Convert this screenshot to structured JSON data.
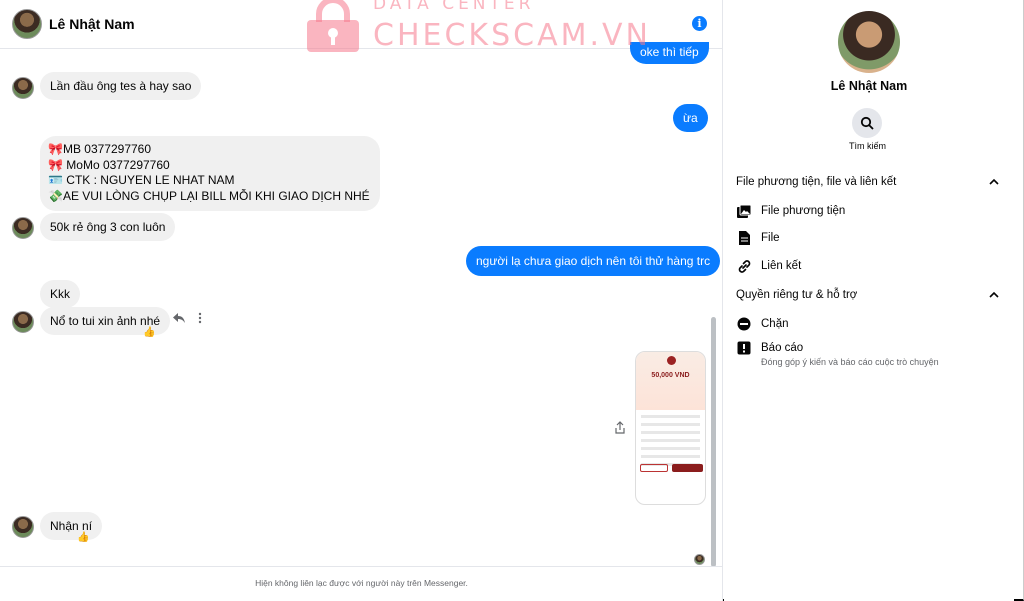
{
  "header": {
    "contact_name": "Lê Nhật Nam",
    "info_icon": "info-icon"
  },
  "messages": [
    {
      "dir": "out",
      "text": "oke thì tiếp"
    },
    {
      "dir": "in",
      "text": "Lần đầu ông tes à hay sao"
    },
    {
      "dir": "out",
      "text": "ừa"
    },
    {
      "dir": "in",
      "lines": [
        "🎀MB 0377297760",
        "🎀 MoMo 0377297760",
        "🪪 CTK : NGUYEN LE NHAT NAM",
        "💸AE VUI LÒNG CHỤP LẠI BILL MỖI KHI GIAO DỊCH NHÉ"
      ]
    },
    {
      "dir": "in",
      "text": "50k rẻ ông 3 con luôn"
    },
    {
      "dir": "out",
      "text": "người lạ chưa giao dịch nên tôi thử hàng trc"
    },
    {
      "dir": "in",
      "text": "Kkk"
    },
    {
      "dir": "in",
      "text": "Nổ to tui xin ảnh nhé",
      "reaction": "👍"
    },
    {
      "dir": "out",
      "attachment": "image",
      "amount": "50,000 VND"
    },
    {
      "dir": "in",
      "text": "Nhận ní",
      "reaction": "👍"
    }
  ],
  "footer": {
    "notice": "Hiện không liên lạc được với người này trên Messenger."
  },
  "panel": {
    "name": "Lê Nhật Nam",
    "search_label": "Tìm kiếm",
    "section_media": "File phương tiện, file và liên kết",
    "media_items": [
      "File phương tiện",
      "File",
      "Liên kết"
    ],
    "section_privacy": "Quyền riêng tư & hỗ trợ",
    "privacy_items": [
      {
        "label": "Chặn"
      },
      {
        "label": "Báo cáo",
        "sub": "Đóng góp ý kiến và báo cáo cuộc trò chuyện"
      }
    ]
  },
  "watermark": {
    "line1": "DATA CENTER",
    "line2": "CHECKSCAM.VN"
  },
  "colors": {
    "accent": "#0a7cff",
    "bubble_in": "#f0f0f0",
    "watermark": "#f5788c"
  }
}
